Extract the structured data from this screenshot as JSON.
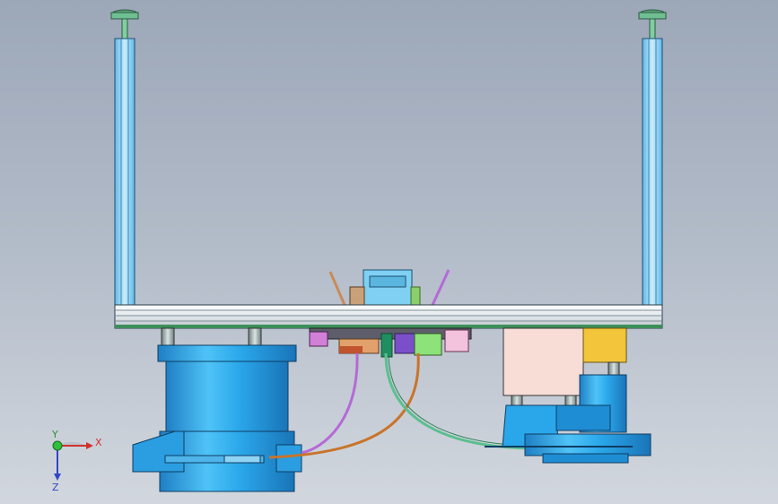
{
  "triad": {
    "x_label": "X",
    "y_label": "Y",
    "z_label": "Z"
  },
  "colors": {
    "background_top": "#9ca7b8",
    "background_bottom": "#d2d7de",
    "column_blue": "#2fa8e8",
    "frame_blue": "#7ec8ef",
    "rail_light": "#e9eef2",
    "tube_purple": "#b46ad6",
    "tube_orange": "#c9742a",
    "tube_green": "#5bbf8f",
    "block_pink": "#f7ddd6",
    "block_yellow": "#f2c53a"
  }
}
